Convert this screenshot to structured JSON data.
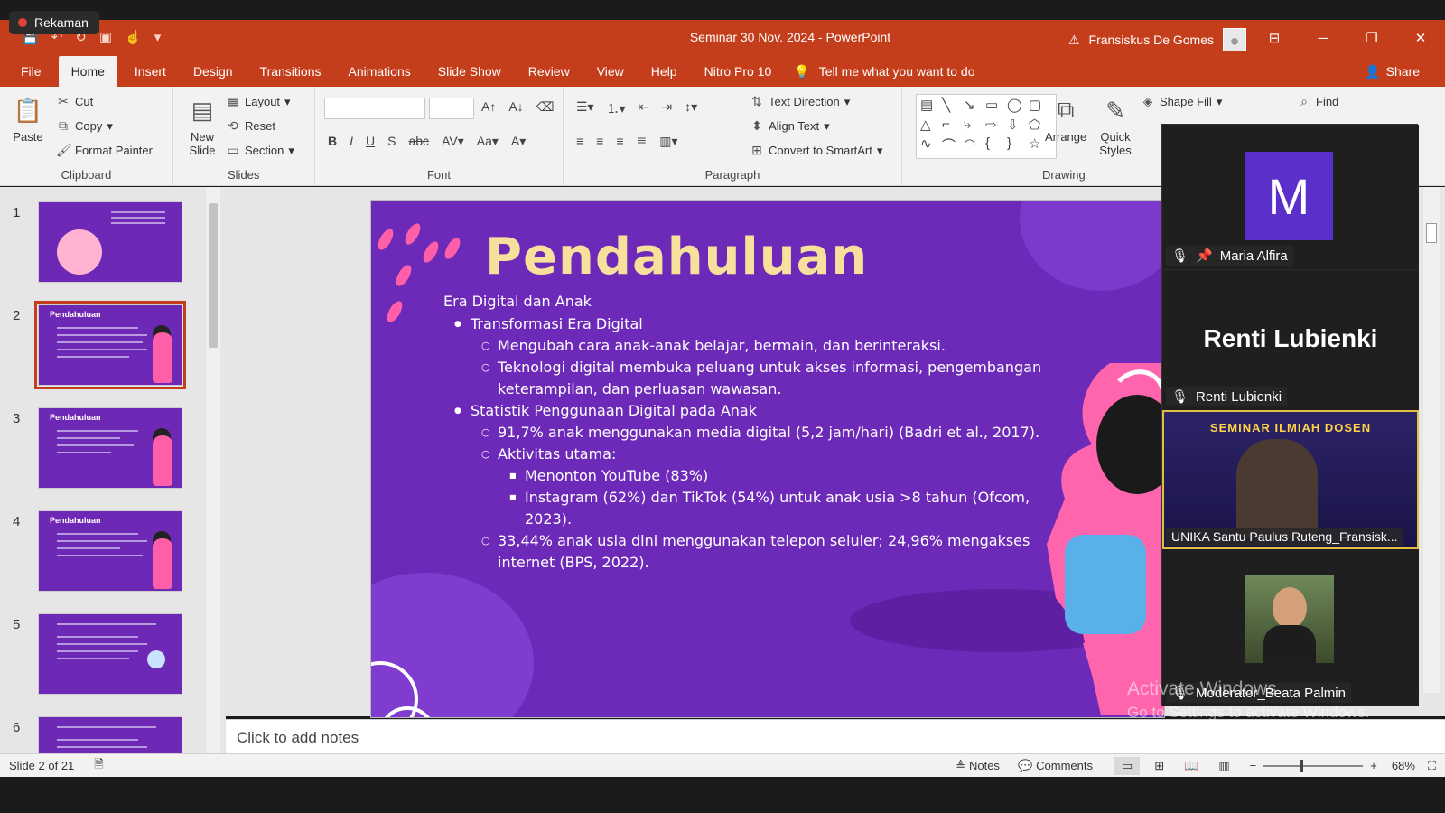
{
  "recording": {
    "label": "Rekaman"
  },
  "titlebar": {
    "doc_title": "Seminar 30 Nov. 2024  -  PowerPoint",
    "user_name": "Fransiskus De Gomes"
  },
  "menu": {
    "tabs": [
      "File",
      "Home",
      "Insert",
      "Design",
      "Transitions",
      "Animations",
      "Slide Show",
      "Review",
      "View",
      "Help",
      "Nitro Pro 10"
    ],
    "active": "Home",
    "tell_me": "Tell me what you want to do",
    "share": "Share"
  },
  "ribbon": {
    "clipboard": {
      "paste": "Paste",
      "cut": "Cut",
      "copy": "Copy",
      "format_painter": "Format Painter",
      "label": "Clipboard"
    },
    "slides": {
      "new_slide": "New Slide",
      "layout": "Layout",
      "reset": "Reset",
      "section": "Section",
      "label": "Slides"
    },
    "font": {
      "label": "Font"
    },
    "paragraph": {
      "text_direction": "Text Direction",
      "align_text": "Align Text",
      "convert_smartart": "Convert to SmartArt",
      "label": "Paragraph"
    },
    "drawing": {
      "arrange": "Arrange",
      "quick_styles": "Quick Styles",
      "shape_fill": "Shape Fill",
      "label": "Drawing"
    },
    "editing": {
      "find": "Find"
    }
  },
  "thumbnails": [
    {
      "num": "1"
    },
    {
      "num": "2",
      "title": "Pendahuluan"
    },
    {
      "num": "3",
      "title": "Pendahuluan"
    },
    {
      "num": "4",
      "title": "Pendahuluan"
    },
    {
      "num": "5"
    },
    {
      "num": "6"
    }
  ],
  "slide": {
    "title": "Pendahuluan",
    "lines": [
      {
        "level": 0,
        "text": "Era Digital dan Anak"
      },
      {
        "level": 1,
        "text": "Transformasi Era Digital"
      },
      {
        "level": 2,
        "text": "Mengubah cara anak-anak belajar, bermain, dan berinteraksi."
      },
      {
        "level": 2,
        "text": "Teknologi digital membuka peluang untuk akses informasi, pengembangan keterampilan, dan perluasan wawasan."
      },
      {
        "level": 1,
        "text": "Statistik Penggunaan Digital pada Anak"
      },
      {
        "level": 2,
        "text": "91,7% anak menggunakan media digital (5,2 jam/hari) (Badri et al., 2017)."
      },
      {
        "level": 2,
        "text": "Aktivitas utama:"
      },
      {
        "level": 3,
        "text": "Menonton YouTube (83%)"
      },
      {
        "level": 3,
        "text": "Instagram (62%) dan TikTok (54%) untuk anak usia >8 tahun (Ofcom, 2023)."
      },
      {
        "level": 2,
        "text": "33,44% anak usia dini menggunakan telepon seluler; 24,96% mengakses internet (BPS, 2022)."
      }
    ]
  },
  "notes": {
    "placeholder": "Click to add notes"
  },
  "status": {
    "slide_info": "Slide 2 of 21",
    "notes": "Notes",
    "comments": "Comments",
    "zoom": "68%"
  },
  "meeting": {
    "participants": [
      {
        "initial": "M",
        "name": "Maria Alfira"
      },
      {
        "name": "Renti Lubienki",
        "big_name": "Renti Lubienki"
      },
      {
        "name": "UNIKA Santu Paulus Ruteng_Fransisk...",
        "banner": "SEMINAR ILMIAH DOSEN"
      },
      {
        "name": "Moderator_Beata Palmin"
      }
    ]
  },
  "watermark": {
    "line1": "Activate Windows",
    "line2": "Go to Settings to activate Windows."
  }
}
